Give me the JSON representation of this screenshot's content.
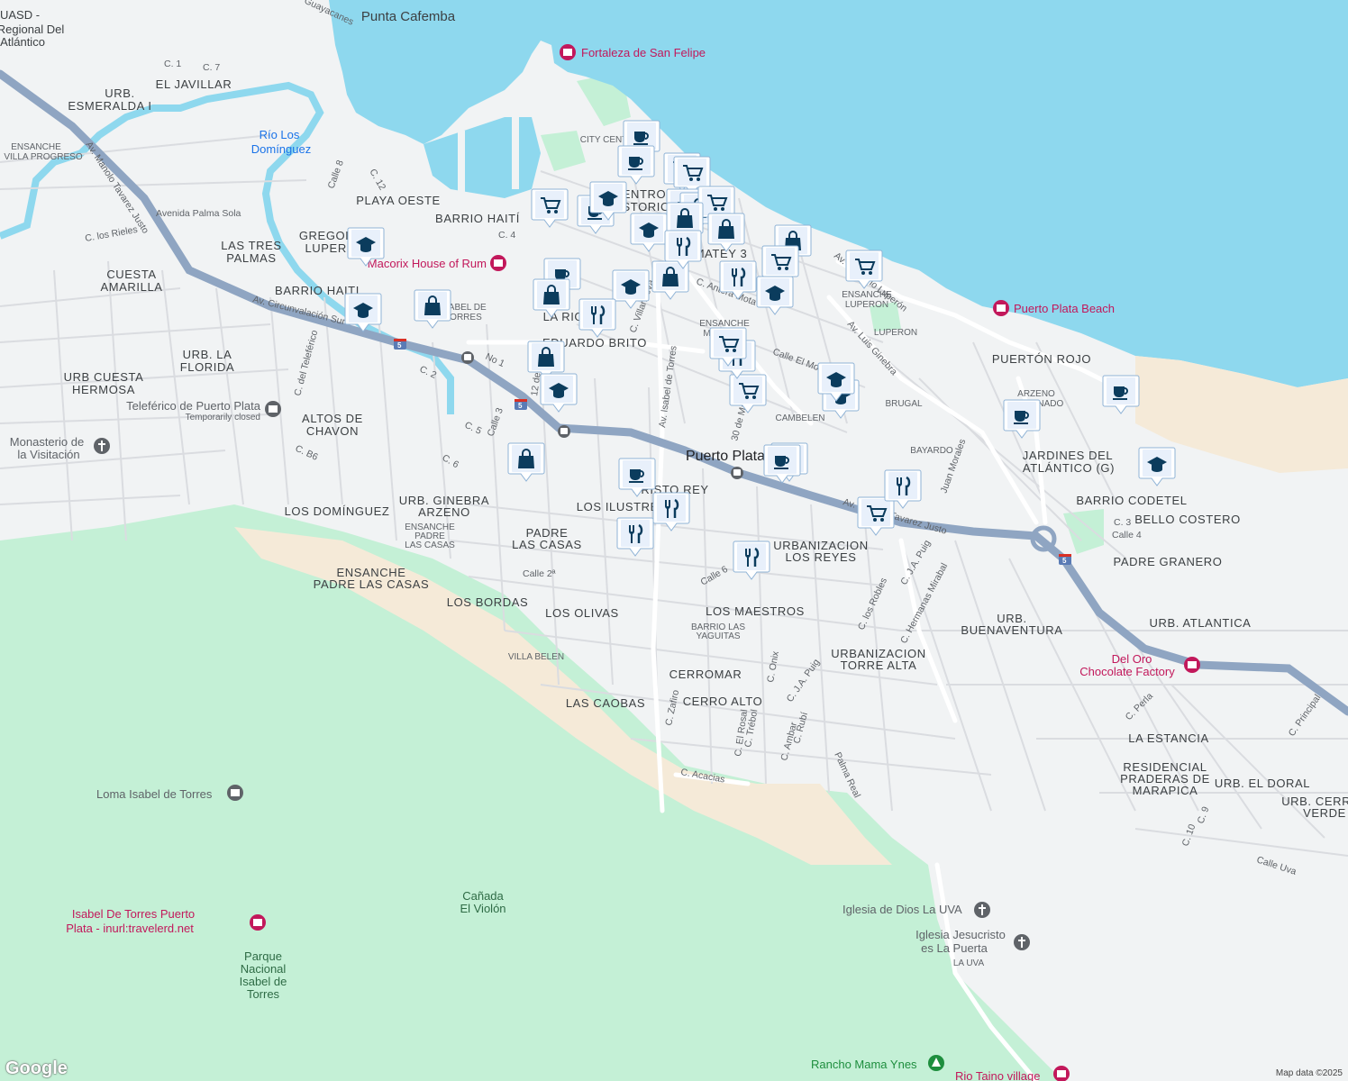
{
  "map": {
    "attribution": "Map data ©2025",
    "logo": "Google",
    "colors": {
      "water": "#8ed8ee",
      "land": "#f1f3f4",
      "park": "#c4f0d6",
      "sand": "#f5ead8",
      "road": "#ffffff",
      "highway": "#8fa5c2",
      "marker": "#0b3c5d",
      "poi_pink": "#c2185b",
      "poi_green": "#1e8e3e",
      "poi_grey": "#5f6368"
    }
  },
  "area_labels": [
    {
      "text": "Punta Cafemba"
    },
    {
      "text": "UASD -"
    },
    {
      "text": "Regional Del"
    },
    {
      "text": "Atlántico"
    },
    {
      "text": "EL JAVILLAR"
    },
    {
      "text": "URB."
    },
    {
      "text": "ESMERALDA I"
    },
    {
      "text": "ENSANCHE"
    },
    {
      "text": "VILLA PROGRESO"
    },
    {
      "text": "PLAYA OESTE"
    },
    {
      "text": "BARRIO HAITÍ"
    },
    {
      "text": "GREGORIO"
    },
    {
      "text": "LUPERÓN"
    },
    {
      "text": "LAS TRES"
    },
    {
      "text": "PALMAS"
    },
    {
      "text": "CUESTA"
    },
    {
      "text": "AMARILLA"
    },
    {
      "text": "BARRIO HAITI"
    },
    {
      "text": "ISABEL DE"
    },
    {
      "text": "TORRES"
    },
    {
      "text": "URB. LA"
    },
    {
      "text": "FLORIDA"
    },
    {
      "text": "URB CUESTA"
    },
    {
      "text": "HERMOSA"
    },
    {
      "text": "ALTOS DE"
    },
    {
      "text": "CHAVON"
    },
    {
      "text": "URB. GINEBRA"
    },
    {
      "text": "ARZENO"
    },
    {
      "text": "LOS DOMÍNGUEZ"
    },
    {
      "text": "ENSANCHE"
    },
    {
      "text": "PADRE"
    },
    {
      "text": "LAS CASAS"
    },
    {
      "text": "PADRE"
    },
    {
      "text": "LAS CASAS"
    },
    {
      "text": "ENSANCHE"
    },
    {
      "text": "PADRE LAS CASAS"
    },
    {
      "text": "LOS BORDAS"
    },
    {
      "text": "LOS OLIVAS"
    },
    {
      "text": "VILLA BELEN"
    },
    {
      "text": "LAS CAOBAS"
    },
    {
      "text": "CERRO ALTO"
    },
    {
      "text": "CERROMAR"
    },
    {
      "text": "LOS MAESTROS"
    },
    {
      "text": "BARRIO LAS"
    },
    {
      "text": "YAGUITAS"
    },
    {
      "text": "URBANIZACION"
    },
    {
      "text": "LOS REYES"
    },
    {
      "text": "URBANIZACION"
    },
    {
      "text": "TORRE ALTA"
    },
    {
      "text": "URB."
    },
    {
      "text": "BUENAVENTURA"
    },
    {
      "text": "CRISTO REY"
    },
    {
      "text": "LOS ILUSTRES"
    },
    {
      "text": "CAMBELEN"
    },
    {
      "text": "BRUGAL"
    },
    {
      "text": "BAYARDO"
    },
    {
      "text": "LUPERON"
    },
    {
      "text": "ENSANCHE"
    },
    {
      "text": "LUPERON"
    },
    {
      "text": "ENSANCHE"
    },
    {
      "text": "MIRAMAR"
    },
    {
      "text": "PUERTÓN ROJO"
    },
    {
      "text": "ARZENO"
    },
    {
      "text": "RELLENADO"
    },
    {
      "text": "JARDINES DEL"
    },
    {
      "text": "ATLÁNTICO (G)"
    },
    {
      "text": "BARRIO CODETEL"
    },
    {
      "text": "BELLO COSTERO"
    },
    {
      "text": "PADRE GRANERO"
    },
    {
      "text": "URB. ATLANTICA"
    },
    {
      "text": "LA ESTANCIA"
    },
    {
      "text": "RESIDENCIAL"
    },
    {
      "text": "PRADERAS DE"
    },
    {
      "text": "MARAPICA"
    },
    {
      "text": "URB. EL DORAL"
    },
    {
      "text": "URB. CERRO"
    },
    {
      "text": "VERDE"
    },
    {
      "text": "LA RIGA"
    },
    {
      "text": "EDUARDO BRITO"
    },
    {
      "text": "CENTRO"
    },
    {
      "text": "HISTORICO"
    },
    {
      "text": "MATEY 3"
    },
    {
      "text": "CITY CENTER"
    },
    {
      "text": "LA UVA"
    },
    {
      "text": "Cañada"
    },
    {
      "text": "El Violón"
    },
    {
      "text": "Parque"
    },
    {
      "text": "Nacional"
    },
    {
      "text": "Isabel de"
    },
    {
      "text": "Torres"
    },
    {
      "text": "Puerto Plata"
    }
  ],
  "pois": [
    {
      "name": "Fortaleza de San Felipe",
      "icon": "museum-icon"
    },
    {
      "name": "Río Los",
      "icon": "none"
    },
    {
      "name": "Domínguez",
      "icon": "none"
    },
    {
      "name": "Macorix House of Rum",
      "icon": "museum-icon"
    },
    {
      "name": "Teleférico de Puerto Plata",
      "icon": "museum-icon"
    },
    {
      "name": "Temporarily closed",
      "icon": "none"
    },
    {
      "name": "Monasterio de",
      "icon": "church-icon"
    },
    {
      "name": "la Visitación",
      "icon": "none"
    },
    {
      "name": "Puerto Plata Beach",
      "icon": "museum-icon"
    },
    {
      "name": "Del Oro",
      "icon": "none"
    },
    {
      "name": "Chocolate Factory",
      "icon": "museum-icon"
    },
    {
      "name": "Loma Isabel de Torres",
      "icon": "landmark-icon"
    },
    {
      "name": "Isabel De Torres Puerto",
      "icon": "none"
    },
    {
      "name": "Plata - inurl:travelerd.net",
      "icon": "museum-icon"
    },
    {
      "name": "Iglesia de Dios La UVA",
      "icon": "church-icon"
    },
    {
      "name": "Iglesia Jesucristo",
      "icon": "none"
    },
    {
      "name": "es La Puerta",
      "icon": "church-icon"
    },
    {
      "name": "Rancho Mama Ynes",
      "icon": "park-icon"
    },
    {
      "name": "Rio Taino village",
      "icon": "museum-icon"
    }
  ],
  "streets": [
    {
      "text": "Av. Manolo Tavarez Justo"
    },
    {
      "text": "Av. Circunvalación Sur"
    },
    {
      "text": "Av. Manolo Tavarez Justo"
    },
    {
      "text": "Avenida Palma Sola"
    },
    {
      "text": "C. los Rieles"
    },
    {
      "text": "C. del Teleférico"
    },
    {
      "text": "Av. Isabel de Torres"
    },
    {
      "text": "Av. Luis Ginebra"
    },
    {
      "text": "Av. Gregorio Luperón"
    },
    {
      "text": "C. Antera Mota"
    },
    {
      "text": "C. Villanueva"
    },
    {
      "text": "Calle El Morro"
    },
    {
      "text": "C. J.A. Puig"
    },
    {
      "text": "C. J.A. Puig"
    },
    {
      "text": "C. Hermanas Mirabal"
    },
    {
      "text": "Juan Morales"
    },
    {
      "text": "C. Acacias"
    },
    {
      "text": "C. Zafiro"
    },
    {
      "text": "C. El Rosal"
    },
    {
      "text": "C. Trébol"
    },
    {
      "text": "C. Ambar"
    },
    {
      "text": "C. Rubí"
    },
    {
      "text": "C. Onix"
    },
    {
      "text": "Palma Real"
    },
    {
      "text": "Calle Uva"
    },
    {
      "text": "C. Principal"
    },
    {
      "text": "C. Perla"
    },
    {
      "text": "Calle 4"
    },
    {
      "text": "C. 3"
    },
    {
      "text": "Calle 2ª"
    },
    {
      "text": "C. los Robles"
    },
    {
      "text": "30 de Marzo"
    },
    {
      "text": "12 de Julio"
    },
    {
      "text": "Calle 8"
    },
    {
      "text": "C. 12"
    },
    {
      "text": "C. 1"
    },
    {
      "text": "C. 7"
    },
    {
      "text": "C. 2"
    },
    {
      "text": "C. 4"
    },
    {
      "text": "C. 5"
    },
    {
      "text": "C. 6"
    },
    {
      "text": "Calle 6"
    },
    {
      "text": "Calle 3"
    },
    {
      "text": "No 1"
    },
    {
      "text": "C. 10"
    },
    {
      "text": "C. 9"
    },
    {
      "text": "C. B6"
    },
    {
      "text": "Guayacanes"
    }
  ],
  "markers": [
    {
      "icon": "coffee-icon"
    },
    {
      "icon": "coffee-icon"
    },
    {
      "icon": "cart-icon"
    },
    {
      "icon": "cart-icon"
    },
    {
      "icon": "cart-icon"
    },
    {
      "icon": "coffee-icon"
    },
    {
      "icon": "school-icon"
    },
    {
      "icon": "bag-icon"
    },
    {
      "icon": "bag-icon"
    },
    {
      "icon": "cart-icon"
    },
    {
      "icon": "school-icon"
    },
    {
      "icon": "bag-icon"
    },
    {
      "icon": "bag-icon"
    },
    {
      "icon": "bag-icon"
    },
    {
      "icon": "restaurant-icon"
    },
    {
      "icon": "cart-icon"
    },
    {
      "icon": "school-icon"
    },
    {
      "icon": "restaurant-icon"
    },
    {
      "icon": "cart-icon"
    },
    {
      "icon": "school-icon"
    },
    {
      "icon": "coffee-icon"
    },
    {
      "icon": "school-icon"
    },
    {
      "icon": "bag-icon"
    },
    {
      "icon": "bag-icon"
    },
    {
      "icon": "restaurant-icon"
    },
    {
      "icon": "school-icon"
    },
    {
      "icon": "bag-icon"
    },
    {
      "icon": "cart-icon"
    },
    {
      "icon": "restaurant-icon"
    },
    {
      "icon": "cart-icon"
    },
    {
      "icon": "school-icon"
    },
    {
      "icon": "bag-icon"
    },
    {
      "icon": "school-icon"
    },
    {
      "icon": "coffee-icon"
    },
    {
      "icon": "school-icon"
    },
    {
      "icon": "bag-icon"
    },
    {
      "icon": "restaurant-icon"
    },
    {
      "icon": "coffee-icon"
    },
    {
      "icon": "restaurant-icon"
    },
    {
      "icon": "restaurant-icon"
    },
    {
      "icon": "restaurant-icon"
    },
    {
      "icon": "coffee-icon"
    },
    {
      "icon": "cart-icon"
    },
    {
      "icon": "coffee-icon"
    },
    {
      "icon": "school-icon"
    },
    {
      "icon": "restaurant-icon"
    }
  ],
  "highway_shields": [
    {
      "text": "5"
    },
    {
      "text": "5"
    },
    {
      "text": "5"
    }
  ]
}
